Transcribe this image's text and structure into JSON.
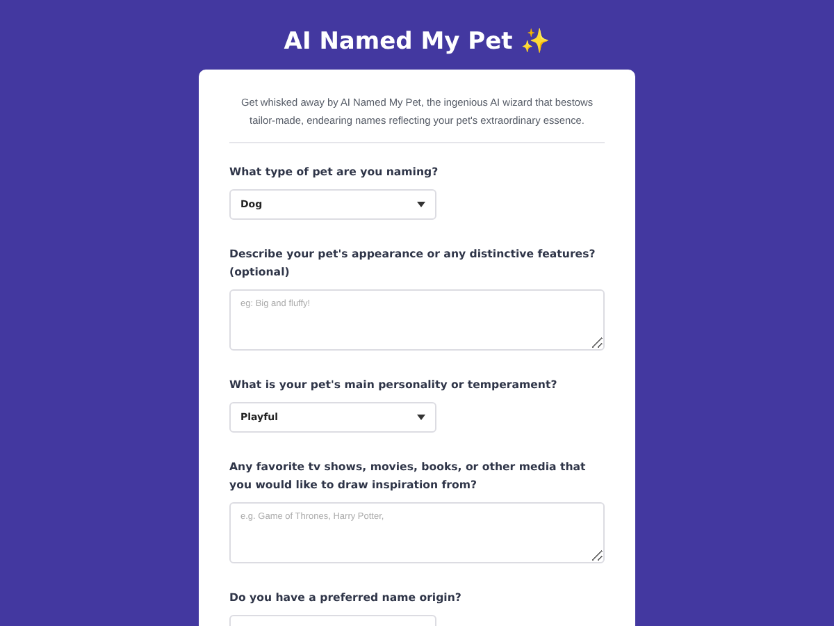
{
  "header": {
    "title": "AI Named My Pet",
    "emoji": "✨"
  },
  "intro": "Get whisked away by AI Named My Pet, the ingenious AI wizard that bestows tailor-made, endearing names reflecting your pet's extraordinary essence.",
  "questions": [
    {
      "kind": "select",
      "label": "What type of pet are you naming?",
      "value": "Dog"
    },
    {
      "kind": "textarea",
      "label": "Describe your pet's appearance or any distinctive features? (optional)",
      "placeholder": "eg: Big and fluffy!"
    },
    {
      "kind": "select",
      "label": "What is your pet's main personality or temperament?",
      "value": "Playful"
    },
    {
      "kind": "textarea",
      "label": "Any favorite tv shows, movies, books, or other media that you would like to draw inspiration from?",
      "placeholder": "e.g. Game of Thrones, Harry Potter,"
    },
    {
      "kind": "select",
      "label": "Do you have a preferred name origin?"
    }
  ]
}
